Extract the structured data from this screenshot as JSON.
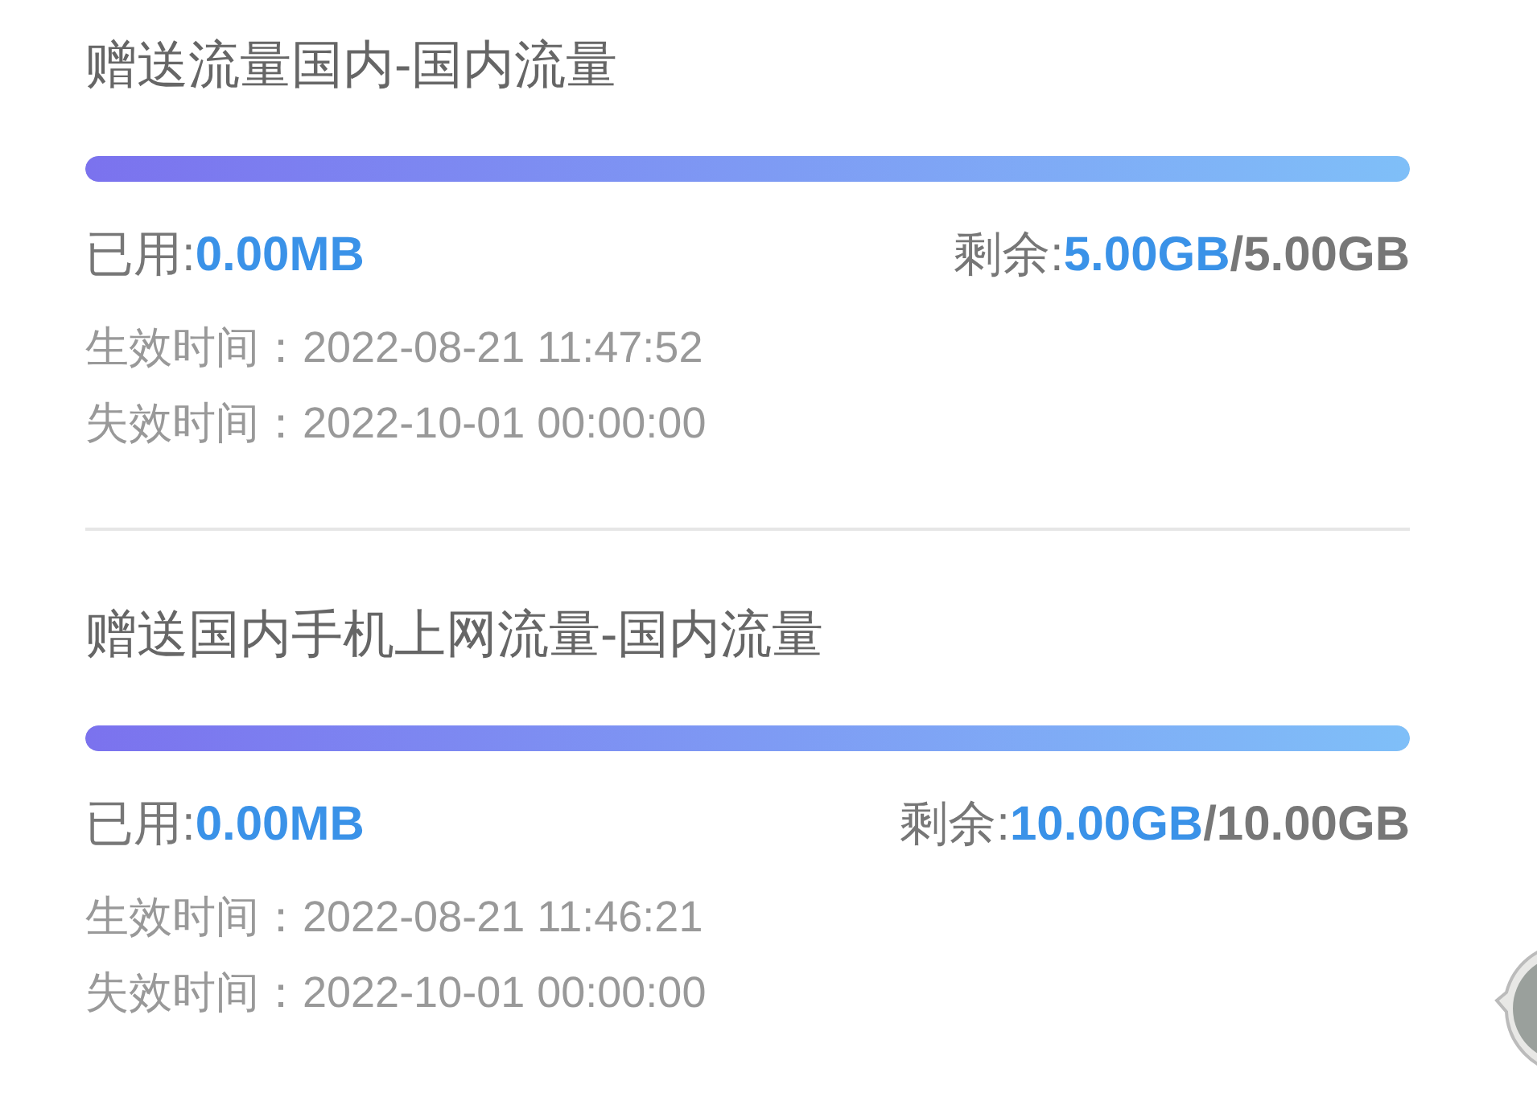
{
  "packages": [
    {
      "title": "赠送流量国内-国内流量",
      "level": 1,
      "used_label": "已用:",
      "used_value": "0.00MB",
      "remain_label": "剩余:",
      "remain_value": "5.00GB",
      "total": "/5.00GB",
      "start_label": "生效时间：",
      "start_time": "2022-08-21 11:47:52",
      "end_label": "失效时间：",
      "end_time": "2022-10-01 00:00:00"
    },
    {
      "title": "赠送国内手机上网流量-国内流量",
      "level": 1,
      "used_label": "已用:",
      "used_value": "0.00MB",
      "remain_label": "剩余:",
      "remain_value": "10.00GB",
      "total": "/10.00GB",
      "start_label": "生效时间：",
      "start_time": "2022-08-21 11:46:21",
      "end_label": "失效时间：",
      "end_time": "2022-10-01 00:00:00"
    }
  ]
}
